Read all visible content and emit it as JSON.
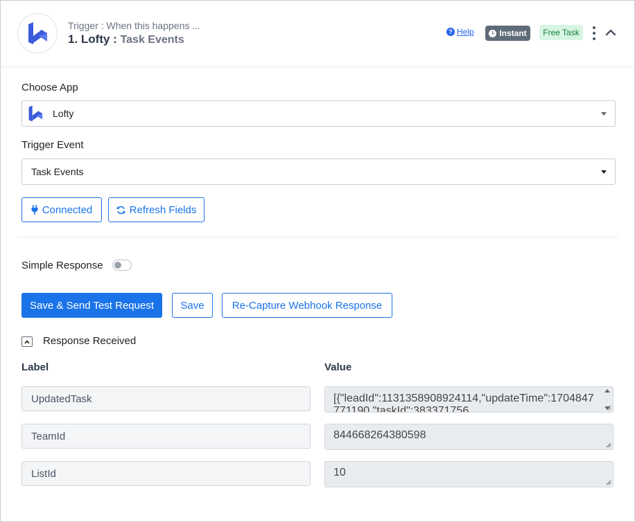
{
  "header": {
    "trigger_caption": "Trigger : When this happens ...",
    "step_title": "1. Lofty : ",
    "step_sub": "Task Events",
    "help_label": "Help",
    "instant_label": "Instant",
    "free_task_label": "Free Task",
    "logo_icon": "lofty-logo-icon"
  },
  "form": {
    "choose_app_label": "Choose App",
    "app_value": "Lofty",
    "trigger_event_label": "Trigger Event",
    "trigger_event_value": "Task Events",
    "connected_label": "Connected",
    "refresh_label": "Refresh Fields",
    "simple_response_label": "Simple Response",
    "simple_response_on": false
  },
  "actions": {
    "save_send_label": "Save & Send Test Request",
    "save_label": "Save",
    "recapture_label": "Re-Capture Webhook Response"
  },
  "response": {
    "title": "Response Received",
    "label_header": "Label",
    "value_header": "Value",
    "rows": [
      {
        "label": "UpdatedTask",
        "value": "[{\"leadId\":1131358908924114,\"updateTime\":1704847771190,\"taskId\":383371756"
      },
      {
        "label": "TeamId",
        "value": "844668264380598"
      },
      {
        "label": "ListId",
        "value": "10"
      }
    ]
  },
  "colors": {
    "accent": "#1a73e8",
    "badge_instant_bg": "#5f6b78",
    "badge_free_bg": "#d7f5e3",
    "badge_free_text": "#15803d",
    "logo_blue": "#3b5bdb"
  }
}
